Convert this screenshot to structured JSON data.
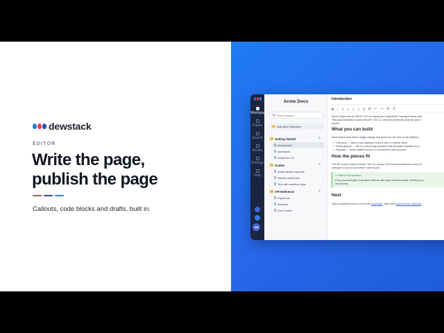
{
  "brand": {
    "name": "dewstack",
    "drop_colors": [
      "#1e7be6",
      "#e63b4a",
      "#2a4fbf"
    ]
  },
  "hero": {
    "eyebrow": "EDITOR",
    "headline_line1": "Write the page,",
    "headline_line2": "publish the page",
    "subtitle": "Callouts, code blocks and drafts, built in.",
    "accent_colors": [
      "#e63b4a",
      "#3b3f9e",
      "#2a7be6"
    ]
  },
  "app": {
    "rail": {
      "items": [
        "Workspace",
        "Pages",
        "Search",
        "Assets",
        "Settings",
        "Help"
      ],
      "active": "Workspace",
      "avatar": "AB"
    },
    "nav": {
      "title": "Acme Docs",
      "search_placeholder": "Search pages...",
      "new_collection": "Add New Collection",
      "groups": [
        {
          "label": "Getting Started",
          "items": [
            "Introduction",
            "Quickstart",
            "Install the CLI"
          ]
        },
        {
          "label": "Guides",
          "items": [
            "Authenticate requests",
            "Handle webhooks",
            "Test with sandbox keys"
          ]
        },
        {
          "label": "API Reference",
          "items": [
            "Payments",
            "Refunds",
            "Error codes"
          ]
        }
      ],
      "active_item": "Introduction"
    },
    "editor": {
      "title": "Introduction",
      "toolbar": [
        "B",
        "I",
        "A",
        "≡",
        "≡",
        "≡",
        "¶",
        "⊞",
        "↩",
        "↪",
        "⊕",
        "☰"
      ],
      "intro_1": "Acme Payments is a REST API for taking card payments, issuing refunds and",
      "intro_2": "This documentation covers the API, the CLI and the webhooks that tell your s",
      "intro_3": "moves.",
      "h_build": "What you can build",
      "build_lead": "Most teams start with a single charge and grow into the rest of the platform:",
      "bullets": [
        "Checkout — take a card payment from a web or mobile client.",
        "Subscriptions — bill on a recurring schedule with proration handled for y",
        "Payouts — move settled funds to a connected bank account."
      ],
      "h_pieces": "How the pieces fit",
      "pieces_1": "The API is the source of truth. The CLI wraps it for local development, and we",
      "pieces_2": "changes to you so you never have to poll.",
      "callout_title": "✔ Start in the sandbox",
      "callout_1": "Every account gets a sandbox with its own keys and test cards. Nothing you",
      "callout_2": "real money.",
      "h_next": "Next",
      "next_pre": "Take a payment end to end in the ",
      "next_link1": "quickstart",
      "next_mid": ", then read ",
      "next_link2": "Authenticate requests",
      "next_post": "."
    }
  }
}
